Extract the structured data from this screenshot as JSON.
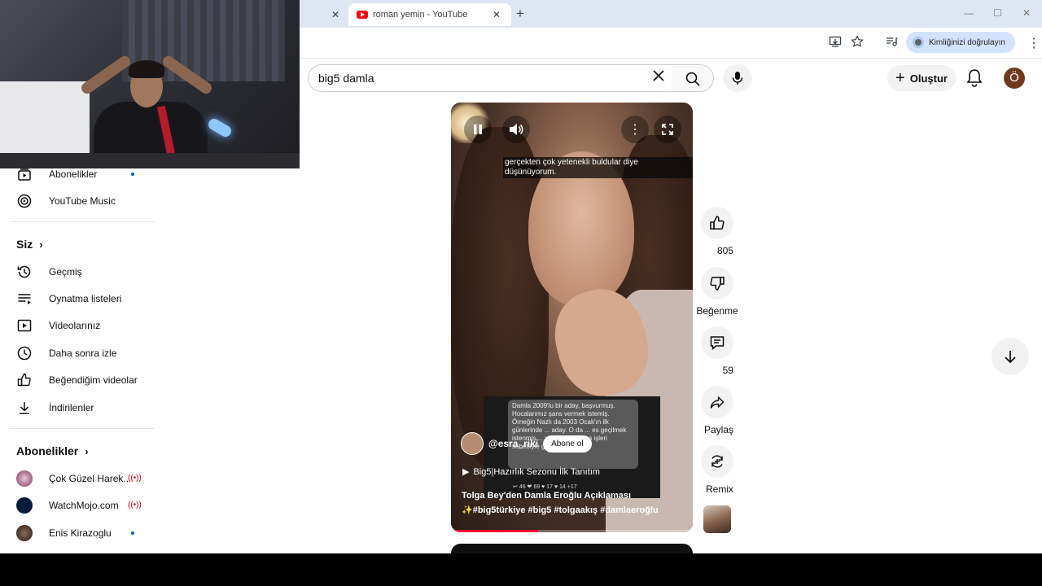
{
  "browser": {
    "tabs": [
      {
        "label": ""
      },
      {
        "label": "roman yemin - YouTube"
      }
    ],
    "new_tab": "+",
    "verify_label": "Kimliğinizi doğrulayın"
  },
  "header": {
    "search_value": "big5 damla",
    "create_label": "Oluştur",
    "avatar_letter": "Ö"
  },
  "sidebar": {
    "top_items": [
      {
        "label": "Abonelikler",
        "icon": "subscriptions-icon"
      },
      {
        "label": "YouTube Music",
        "icon": "youtube-music-icon"
      }
    ],
    "you_heading": "Siz",
    "you_items": [
      {
        "label": "Geçmiş",
        "icon": "history-icon"
      },
      {
        "label": "Oynatma listeleri",
        "icon": "playlists-icon"
      },
      {
        "label": "Videolarınız",
        "icon": "your-videos-icon"
      },
      {
        "label": "Daha sonra izle",
        "icon": "watch-later-icon"
      },
      {
        "label": "Beğendiğim videolar",
        "icon": "liked-videos-icon"
      },
      {
        "label": "İndirilenler",
        "icon": "downloads-icon"
      }
    ],
    "subs_heading": "Abonelikler",
    "subscriptions": [
      {
        "label": "Çok Güzel Harek...",
        "status": "live"
      },
      {
        "label": "WatchMojo.com",
        "status": "live"
      },
      {
        "label": "Enis Kirazoglu",
        "status": "new"
      }
    ]
  },
  "short": {
    "caption": "gerçekten çok yetenekli buldular diye düşünüyorum.",
    "inner_text": "Damla 2009'lu bir aday, başvurmuş. Hocalarımız şans vermek istemiş. Örneğin Nazlı da 2003 Ocak'ın ilk günlerinde ... aday. O da ... es geçilmek istenmiş ... yıl girecekti ama işleri sebebiyle giremeşti. Bu ...",
    "inner_reactions": "↩ 46   ❤ 69   ♥ 17   ♥ 14   +17",
    "channel": "@esra_riki",
    "subscribe_label": "Abone ol",
    "playlist": "Big5|Hazırlık Sezonu İlk Tanıtım",
    "title": "Tolga Bey'den Damla Eroğlu Açıklaması",
    "tags": "✨#big5türkiye #big5 #tolgaakış #damlaeroğlu",
    "progress": 0.36
  },
  "actions": {
    "like_count": "805",
    "dislike_label": "Beğenme",
    "comment_count": "59",
    "share_label": "Paylaş",
    "remix_label": "Remix"
  }
}
